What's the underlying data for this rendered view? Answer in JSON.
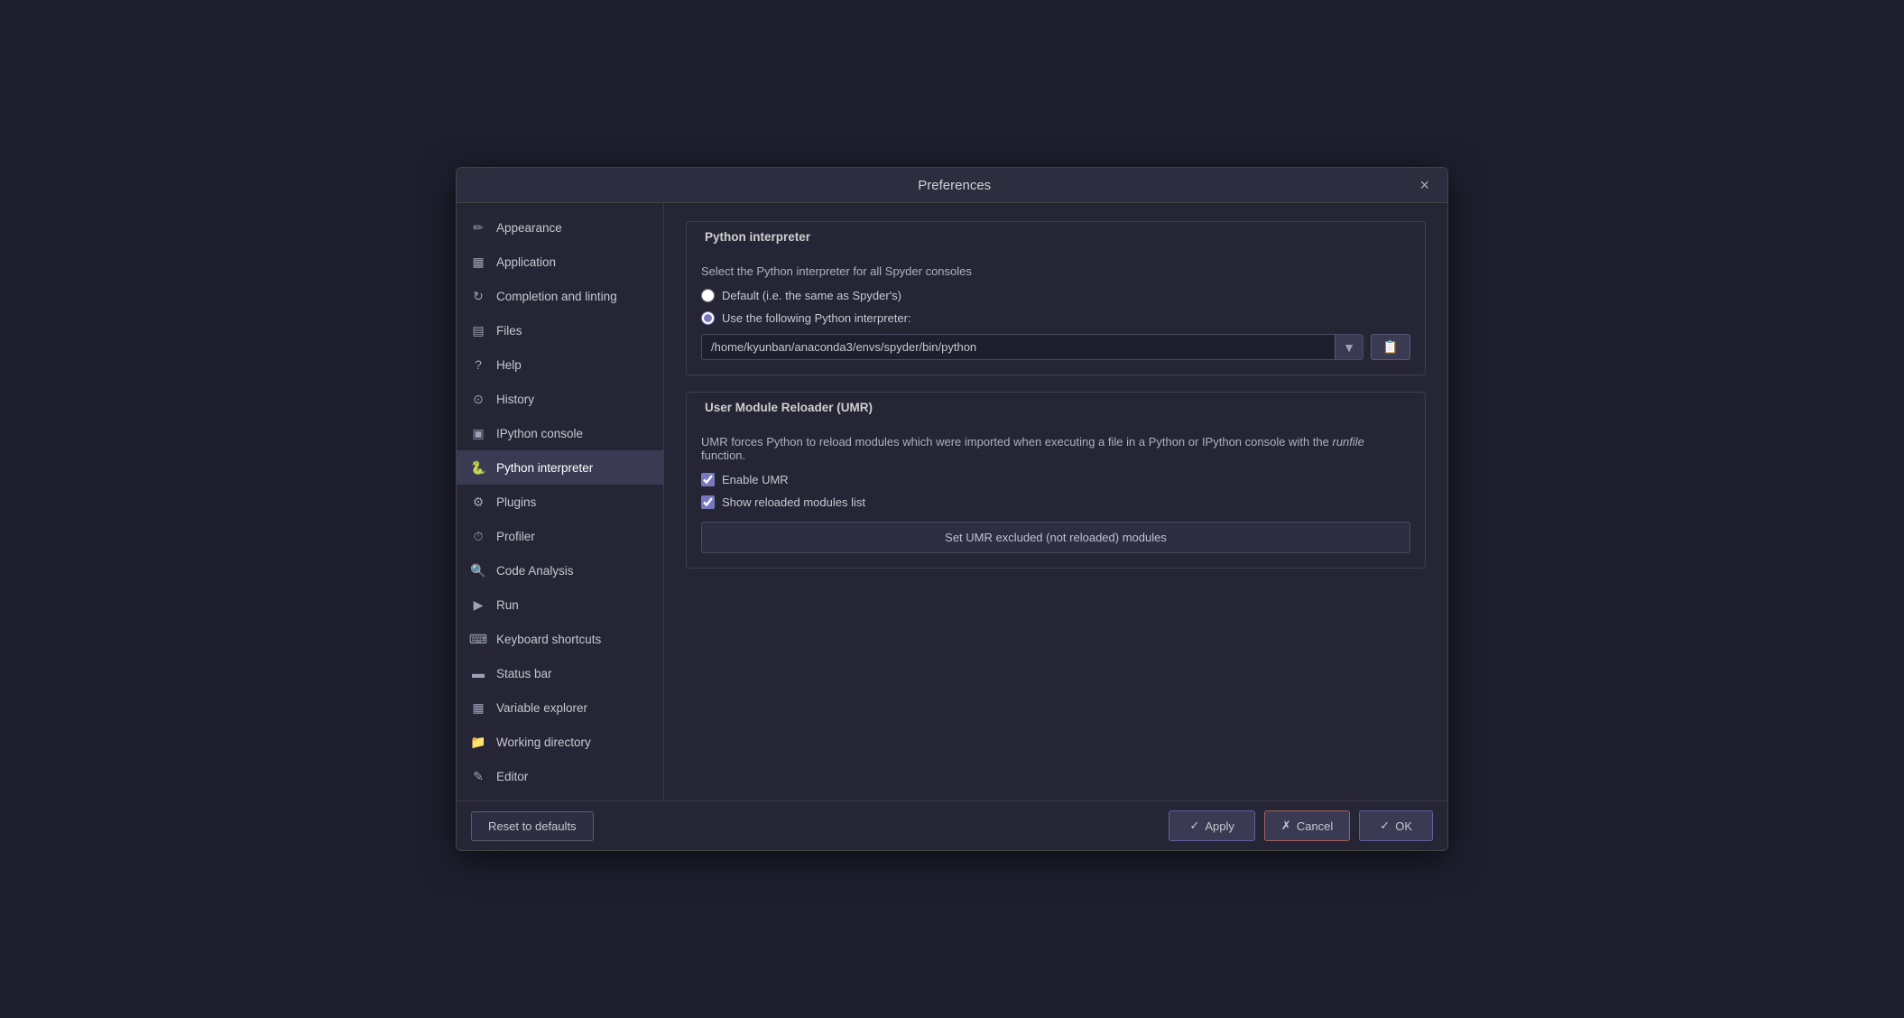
{
  "dialog": {
    "title": "Preferences",
    "close_label": "×"
  },
  "sidebar": {
    "items": [
      {
        "id": "appearance",
        "label": "Appearance",
        "icon": "✏"
      },
      {
        "id": "application",
        "label": "Application",
        "icon": "▦"
      },
      {
        "id": "completion",
        "label": "Completion and linting",
        "icon": "↻"
      },
      {
        "id": "files",
        "label": "Files",
        "icon": "▤"
      },
      {
        "id": "help",
        "label": "Help",
        "icon": "?"
      },
      {
        "id": "history",
        "label": "History",
        "icon": "⊙"
      },
      {
        "id": "ipython",
        "label": "IPython console",
        "icon": "▣"
      },
      {
        "id": "python-interpreter",
        "label": "Python interpreter",
        "icon": "🐍",
        "active": true
      },
      {
        "id": "plugins",
        "label": "Plugins",
        "icon": "⚙"
      },
      {
        "id": "profiler",
        "label": "Profiler",
        "icon": "⏱"
      },
      {
        "id": "code-analysis",
        "label": "Code Analysis",
        "icon": "🔍"
      },
      {
        "id": "run",
        "label": "Run",
        "icon": "▶"
      },
      {
        "id": "keyboard",
        "label": "Keyboard shortcuts",
        "icon": "⌨"
      },
      {
        "id": "status-bar",
        "label": "Status bar",
        "icon": "▬"
      },
      {
        "id": "variable-explorer",
        "label": "Variable explorer",
        "icon": "▦"
      },
      {
        "id": "working-directory",
        "label": "Working directory",
        "icon": "📁"
      },
      {
        "id": "editor",
        "label": "Editor",
        "icon": "✎"
      }
    ]
  },
  "main": {
    "python_interpreter_section": {
      "title": "Python interpreter",
      "description": "Select the Python interpreter for all Spyder consoles",
      "radio_default": {
        "label": "Default (i.e. the same as Spyder's)",
        "checked": false
      },
      "radio_custom": {
        "label": "Use the following Python interpreter:",
        "checked": true
      },
      "path": "/home/kyunban/anaconda3/envs/spyder/bin/python",
      "browse_icon": "📋"
    },
    "umr_section": {
      "title": "User Module Reloader (UMR)",
      "description": "UMR forces Python to reload modules which were imported when executing a file in a Python or IPython console with the ",
      "description_italic": "runfile",
      "description_end": " function.",
      "enable_umr": {
        "label": "Enable UMR",
        "checked": true
      },
      "show_reloaded": {
        "label": "Show reloaded modules list",
        "checked": true
      },
      "set_excluded_btn": "Set UMR excluded (not reloaded) modules"
    }
  },
  "footer": {
    "reset_label": "Reset to defaults",
    "apply_label": "Apply",
    "cancel_label": "Cancel",
    "ok_label": "OK",
    "apply_icon": "✓",
    "cancel_icon": "✗",
    "ok_icon": "✓"
  }
}
